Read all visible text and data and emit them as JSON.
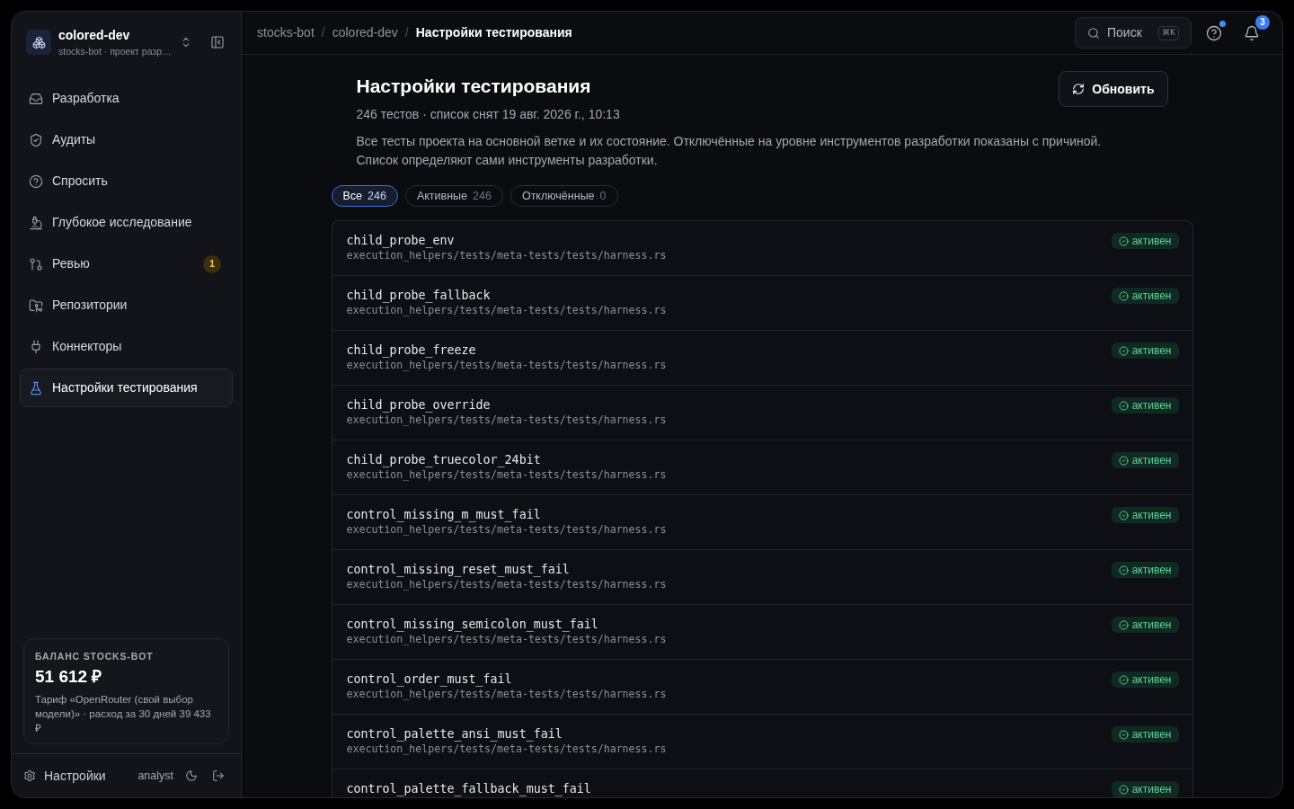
{
  "workspace": {
    "name": "colored-dev",
    "subtitle": "stocks-bot · проект разр…"
  },
  "sidebar": {
    "items": [
      {
        "label": "Разработка",
        "selected": false
      },
      {
        "label": "Аудиты",
        "selected": false
      },
      {
        "label": "Спросить",
        "selected": false
      },
      {
        "label": "Глубокое исследование",
        "selected": false
      },
      {
        "label": "Ревью",
        "selected": false,
        "badge": "1"
      },
      {
        "label": "Репозитории",
        "selected": false
      },
      {
        "label": "Коннекторы",
        "selected": false
      },
      {
        "label": "Настройки тестирования",
        "selected": true
      }
    ]
  },
  "balance": {
    "label": "БАЛАНС STOCKS-BOT",
    "amount": "51 612 ₽",
    "note": "Тариф «OpenRouter (свой выбор модели)» · расход за 30 дней 39 433 ₽"
  },
  "footer": {
    "settings": "Настройки",
    "user": "analyst"
  },
  "breadcrumbs": [
    {
      "label": "stocks-bot",
      "current": false,
      "separator": "/"
    },
    {
      "label": "colored-dev",
      "current": false,
      "separator": "/"
    },
    {
      "label": "Настройки тестирования",
      "current": true
    }
  ],
  "search": {
    "label": "Поиск",
    "shortcut": "⌘K"
  },
  "help": {
    "has_news": true
  },
  "notifications": {
    "count": "3"
  },
  "page": {
    "title": "Настройки тестирования",
    "meta": "246 тестов · список снят 19 авг. 2026 г., 10:13",
    "description": "Все тесты проекта на основной ветке и их состояние. Отключённые на уровне инструментов разработки показаны с причиной. Список определяют сами инструменты разработки.",
    "refresh": "Обновить"
  },
  "filters": [
    {
      "label": "Все",
      "count": "246",
      "selected": true
    },
    {
      "label": "Активные",
      "count": "246",
      "selected": false
    },
    {
      "label": "Отключённые",
      "count": "0",
      "selected": false
    }
  ],
  "tests": [
    {
      "name": "child_probe_env",
      "path": "execution_helpers/tests/meta-tests/tests/harness.rs",
      "status": "активен",
      "kind": "active"
    },
    {
      "name": "child_probe_fallback",
      "path": "execution_helpers/tests/meta-tests/tests/harness.rs",
      "status": "активен",
      "kind": "active"
    },
    {
      "name": "child_probe_freeze",
      "path": "execution_helpers/tests/meta-tests/tests/harness.rs",
      "status": "активен",
      "kind": "active"
    },
    {
      "name": "child_probe_override",
      "path": "execution_helpers/tests/meta-tests/tests/harness.rs",
      "status": "активен",
      "kind": "active"
    },
    {
      "name": "child_probe_truecolor_24bit",
      "path": "execution_helpers/tests/meta-tests/tests/harness.rs",
      "status": "активен",
      "kind": "active"
    },
    {
      "name": "control_missing_m_must_fail",
      "path": "execution_helpers/tests/meta-tests/tests/harness.rs",
      "status": "активен",
      "kind": "active"
    },
    {
      "name": "control_missing_reset_must_fail",
      "path": "execution_helpers/tests/meta-tests/tests/harness.rs",
      "status": "активен",
      "kind": "active"
    },
    {
      "name": "control_missing_semicolon_must_fail",
      "path": "execution_helpers/tests/meta-tests/tests/harness.rs",
      "status": "активен",
      "kind": "active"
    },
    {
      "name": "control_order_must_fail",
      "path": "execution_helpers/tests/meta-tests/tests/harness.rs",
      "status": "активен",
      "kind": "active"
    },
    {
      "name": "control_palette_ansi_must_fail",
      "path": "execution_helpers/tests/meta-tests/tests/harness.rs",
      "status": "активен",
      "kind": "active"
    },
    {
      "name": "control_palette_fallback_must_fail",
      "status": "активен",
      "kind": "active"
    }
  ]
}
